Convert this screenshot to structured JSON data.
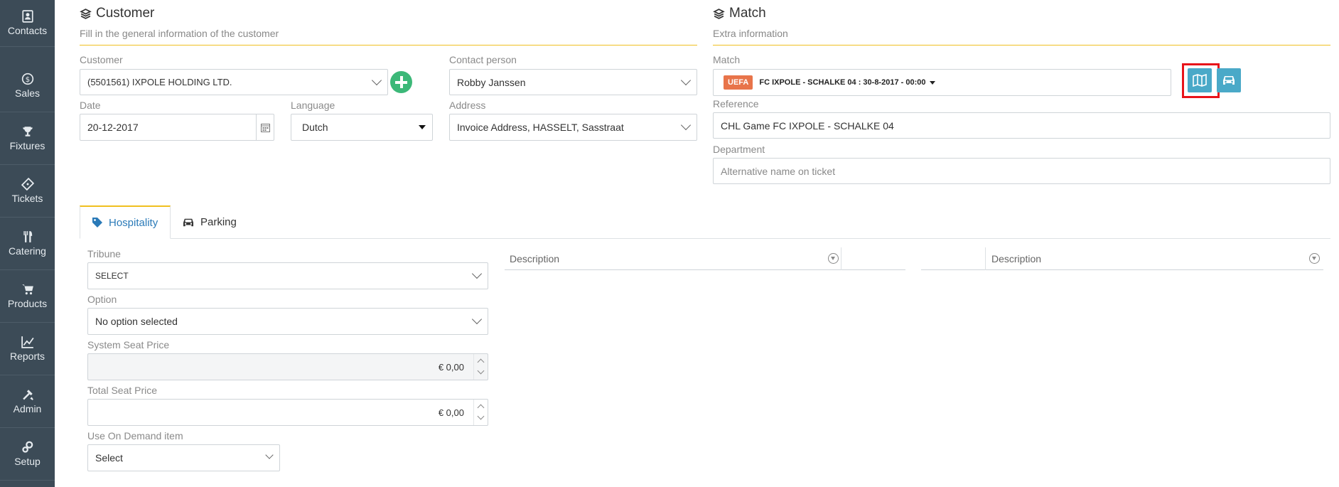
{
  "sidebar": {
    "items": [
      {
        "label": "Contacts",
        "icon": "contacts-icon"
      },
      {
        "label": "Sales",
        "icon": "dollar-icon"
      },
      {
        "label": "Fixtures",
        "icon": "trophy-icon"
      },
      {
        "label": "Tickets",
        "icon": "ticket-icon"
      },
      {
        "label": "Catering",
        "icon": "cutlery-icon"
      },
      {
        "label": "Products",
        "icon": "cart-icon"
      },
      {
        "label": "Reports",
        "icon": "chart-icon"
      },
      {
        "label": "Admin",
        "icon": "tools-icon"
      },
      {
        "label": "Setup",
        "icon": "gears-icon"
      }
    ]
  },
  "customer_section": {
    "title": "Customer",
    "subtitle": "Fill in the general information of the customer",
    "customer_label": "Customer",
    "customer_value": "(5501561) IXPOLE HOLDING LTD.",
    "contact_label": "Contact person",
    "contact_value": "Robby Janssen",
    "date_label": "Date",
    "date_value": "20-12-2017",
    "language_label": "Language",
    "language_value": "Dutch",
    "address_label": "Address",
    "address_value": "Invoice Address, HASSELT, Sasstraat"
  },
  "match_section": {
    "title": "Match",
    "subtitle": "Extra information",
    "match_label": "Match",
    "match_badge": "UEFA",
    "match_value": "FC IXPOLE - SCHALKE 04 : 30-8-2017 - 00:00",
    "reference_label": "Reference",
    "reference_value": "CHL Game FC IXPOLE - SCHALKE 04",
    "department_label": "Department",
    "department_placeholder": "Alternative name on ticket"
  },
  "tabs": [
    {
      "label": "Hospitality",
      "icon": "tag-icon",
      "active": true
    },
    {
      "label": "Parking",
      "icon": "car-icon",
      "active": false
    }
  ],
  "hospitality": {
    "tribune_label": "Tribune",
    "tribune_value": "SELECT",
    "option_label": "Option",
    "option_value": "No option selected",
    "system_price_label": "System Seat Price",
    "system_price_value": "€ 0,00",
    "total_price_label": "Total Seat Price",
    "total_price_value": "€ 0,00",
    "on_demand_label": "Use On Demand item",
    "on_demand_value": "Select"
  },
  "grids": {
    "left_header": "Description",
    "right_header": "Description"
  },
  "colors": {
    "sidebar_bg": "#3c4b57",
    "accent_yellow": "#f0c020",
    "action_blue": "#4aa9c8",
    "add_green": "#3cb878",
    "uefa_orange": "#e8744a",
    "highlight_red": "#e8141a"
  }
}
